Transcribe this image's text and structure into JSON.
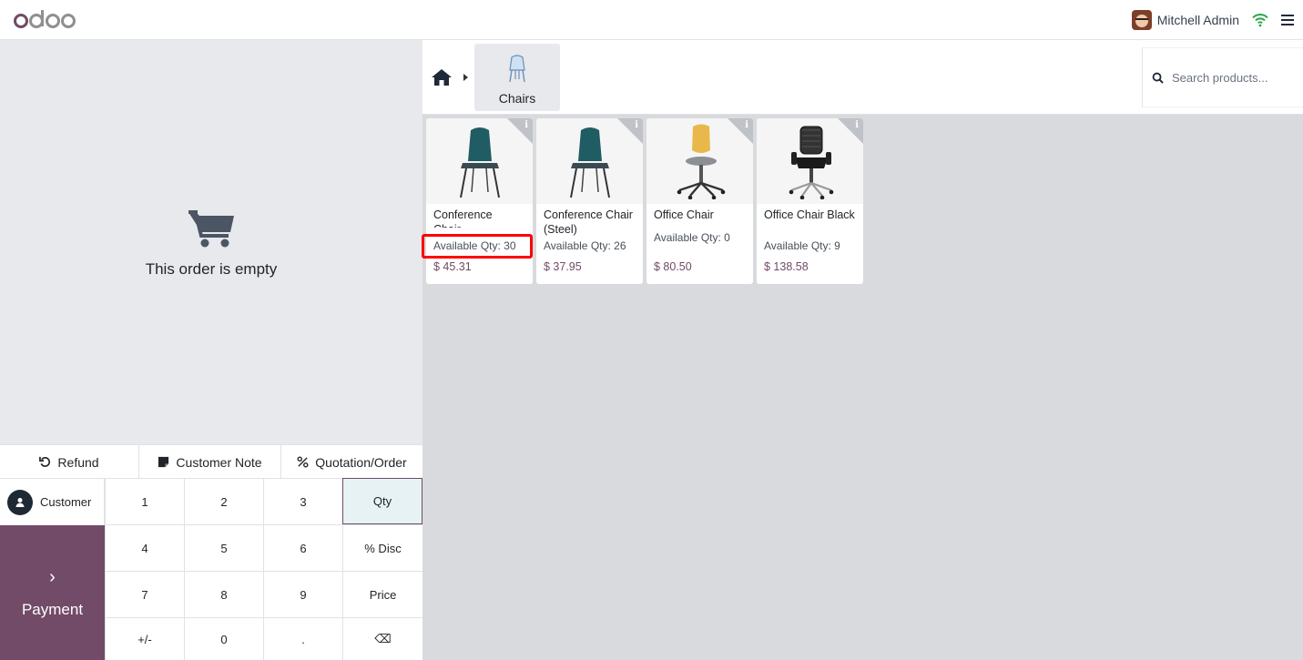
{
  "navbar": {
    "user_name": "Mitchell Admin"
  },
  "order": {
    "empty_text": "This order is empty"
  },
  "controls": {
    "refund": "Refund",
    "customer_note": "Customer Note",
    "quotation_order": "Quotation/Order",
    "customer": "Customer",
    "payment": "Payment"
  },
  "numpad": {
    "keys": [
      "1",
      "2",
      "3",
      "Qty",
      "4",
      "5",
      "6",
      "% Disc",
      "7",
      "8",
      "9",
      "Price",
      "+/-",
      "0",
      ".",
      "⌫"
    ],
    "active": "Qty"
  },
  "category": {
    "name": "Chairs"
  },
  "search": {
    "placeholder": "Search products..."
  },
  "products": [
    {
      "name": "Conference Chair...",
      "qty": "Available Qty: 30",
      "price": "$ 45.31",
      "seat_color": "#1f5c63"
    },
    {
      "name": "Conference Chair (Steel)",
      "qty": "Available Qty: 26",
      "price": "$ 37.95",
      "seat_color": "#1f5c63"
    },
    {
      "name": "Office Chair",
      "qty": "Available Qty: 0",
      "price": "$ 80.50",
      "seat_color": "#e8b84a"
    },
    {
      "name": "Office Chair Black",
      "qty": "Available Qty: 9",
      "price": "$ 138.58",
      "seat_color": "#222222"
    }
  ],
  "colors": {
    "brand": "#714b67",
    "highlight": "#ff0000"
  }
}
